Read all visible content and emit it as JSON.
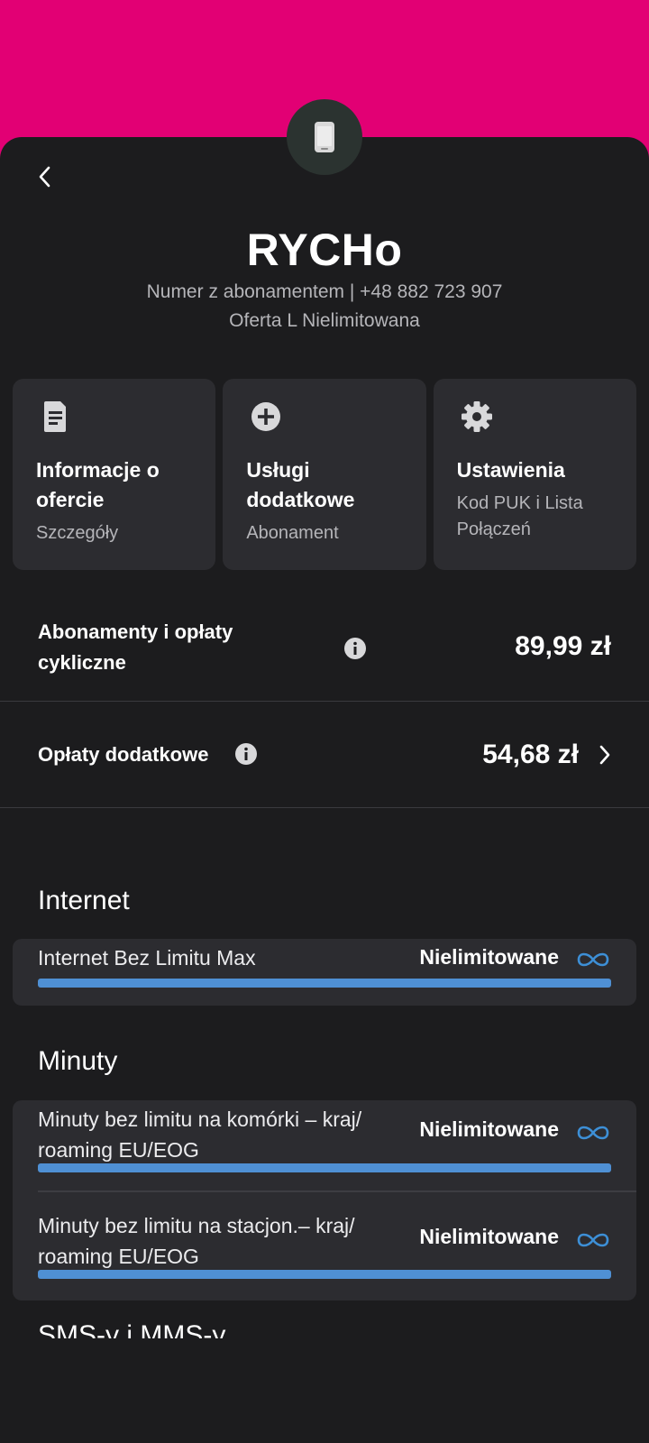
{
  "header": {
    "title": "RYCHo",
    "number_line": "Numer z abonamentem | +48 882 723 907",
    "offer_line": "Oferta L Nielimitowana"
  },
  "cards": [
    {
      "icon": "document-icon",
      "title": "Informacje o ofercie",
      "subtitle": "Szczegóły"
    },
    {
      "icon": "plus-circle-icon",
      "title": "Usługi dodatkowe",
      "subtitle": "Abonament"
    },
    {
      "icon": "gear-icon",
      "title": "Ustawienia",
      "subtitle": "Kod PUK i Lista Połączeń"
    }
  ],
  "fees": {
    "subscription_label": "Abonamenty i opłaty cykliczne",
    "subscription_value": "89,99 zł",
    "extra_label": "Opłaty dodatkowe",
    "extra_value": "54,68 zł"
  },
  "sections": {
    "internet": {
      "title": "Internet",
      "items": [
        {
          "name": "Internet Bez Limitu Max",
          "status": "Nielimitowane",
          "usage_fraction": 1.0
        }
      ]
    },
    "minutes": {
      "title": "Minuty",
      "items": [
        {
          "name": "Minuty bez limitu na komórki – kraj/ roaming EU/EOG",
          "status": "Nielimitowane",
          "usage_fraction": 1.0
        },
        {
          "name": "Minuty bez limitu na stacjon.– kraj/ roaming EU/EOG",
          "status": "Nielimitowane",
          "usage_fraction": 1.0
        }
      ]
    },
    "sms": {
      "title": "SMS-y i MMS-y"
    }
  },
  "colors": {
    "brand": "#e20074",
    "background": "#1c1c1e",
    "card": "#2c2c30",
    "bar": "#4f90d4",
    "infinity": "#3d8fd6"
  }
}
